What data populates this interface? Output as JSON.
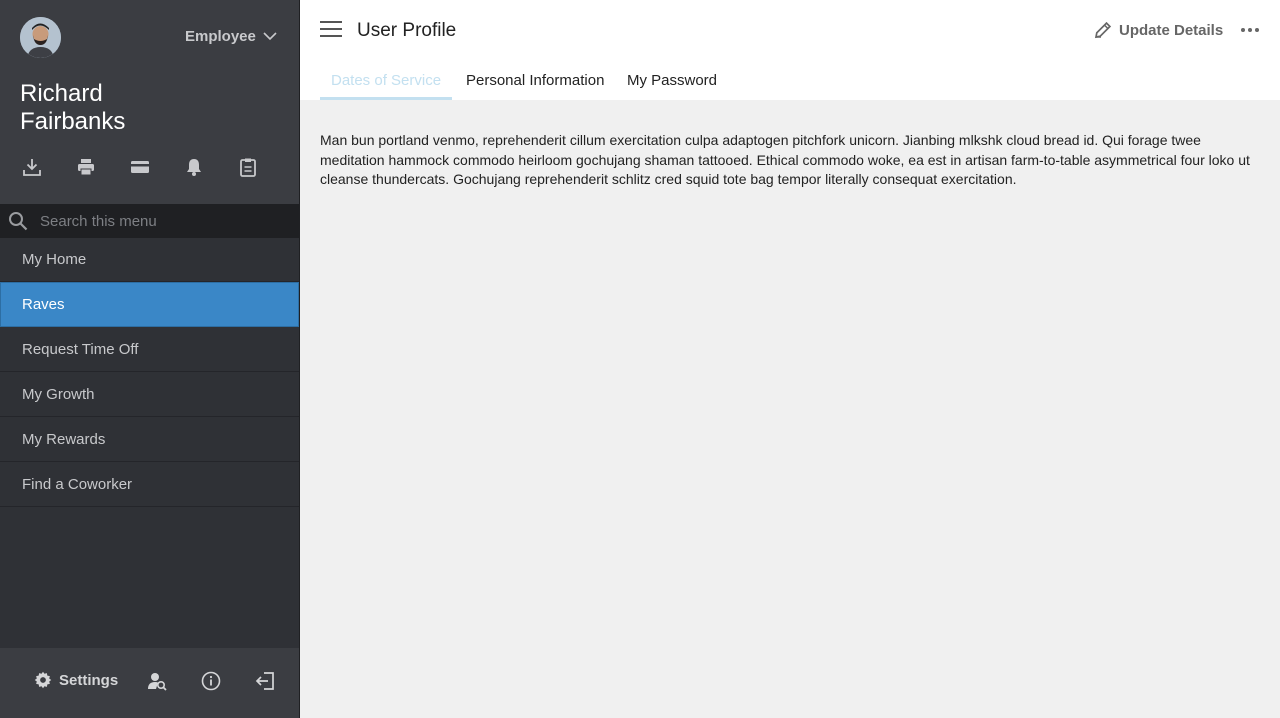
{
  "sidebar": {
    "role_label": "Employee",
    "user_name": "Richard Fairbanks",
    "quick_icons": [
      "download-icon",
      "print-icon",
      "credit-card-icon",
      "bell-icon",
      "clipboard-icon"
    ],
    "search_placeholder": "Search this menu",
    "menu_items": [
      {
        "label": "My Home"
      },
      {
        "label": "Raves",
        "active": true
      },
      {
        "label": "Request Time Off"
      },
      {
        "label": "My Growth"
      },
      {
        "label": "My Rewards"
      },
      {
        "label": "Find a Coworker"
      }
    ],
    "footer": {
      "settings_label": "Settings",
      "icons": [
        "gear-icon",
        "user-search-icon",
        "info-icon",
        "logout-icon"
      ]
    }
  },
  "header": {
    "title": "User Profile",
    "update_label": "Update Details",
    "tabs": [
      {
        "label": "Dates of Service",
        "active": true
      },
      {
        "label": "Personal Information"
      },
      {
        "label": "My Password"
      }
    ]
  },
  "main": {
    "body_text": "Man bun portland venmo, reprehenderit cillum exercitation culpa adaptogen pitchfork unicorn. Jianbing mlkshk cloud bread id. Qui forage twee meditation hammock commodo heirloom gochujang shaman tattooed. Ethical commodo woke, ea est in artisan farm-to-table asymmetrical four loko ut cleanse thundercats. Gochujang reprehenderit schlitz cred squid tote bag tempor literally consequat exercitation."
  },
  "colors": {
    "sidebar_bg": "#2f3136",
    "sidebar_top_bg": "#3b3d42",
    "active_item": "#3a87c7",
    "active_tab": "#c3e0f0",
    "content_bg": "#f0f0f0"
  }
}
